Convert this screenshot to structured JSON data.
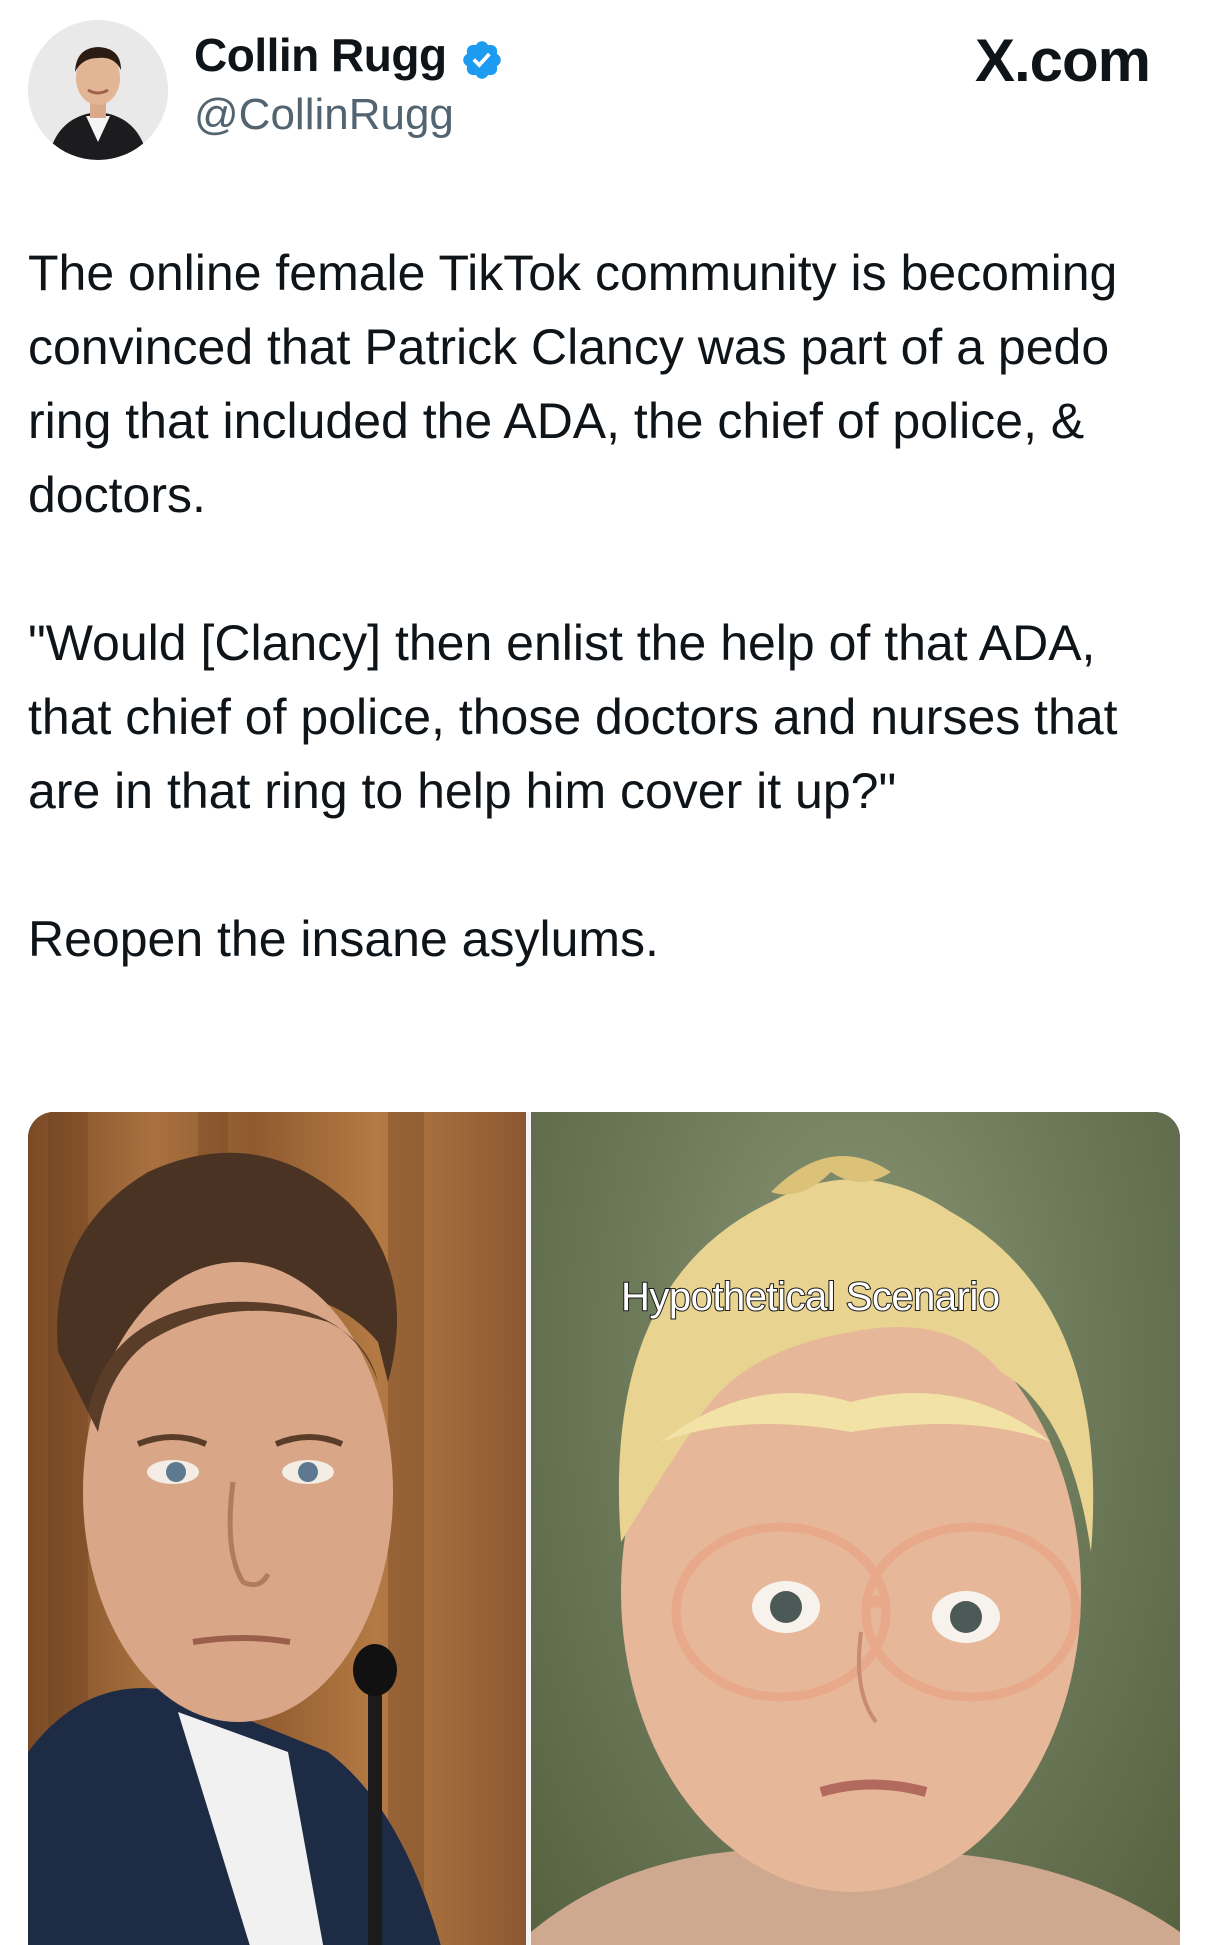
{
  "author": {
    "display_name": "Collin Rugg",
    "handle": "@CollinRugg",
    "verified_badge_color": "#1d9bf0"
  },
  "source_site": "X.com",
  "tweet": {
    "paragraphs": [
      "The online female TikTok community is becoming convinced that Patrick Clancy was part of a pedo ring that included the ADA, the chief of police, & doctors.",
      "\"Would [Clancy] then enlist the help of that ADA, that chief of police, those doctors and nurses that are in that ring to help him cover it up?\"",
      "Reopen the insane asylums."
    ]
  },
  "media": {
    "right_panel_caption": "Hypothetical Scenario"
  },
  "icons": {
    "verified": "verified-badge-icon",
    "site_logo": "x-logo-icon"
  }
}
